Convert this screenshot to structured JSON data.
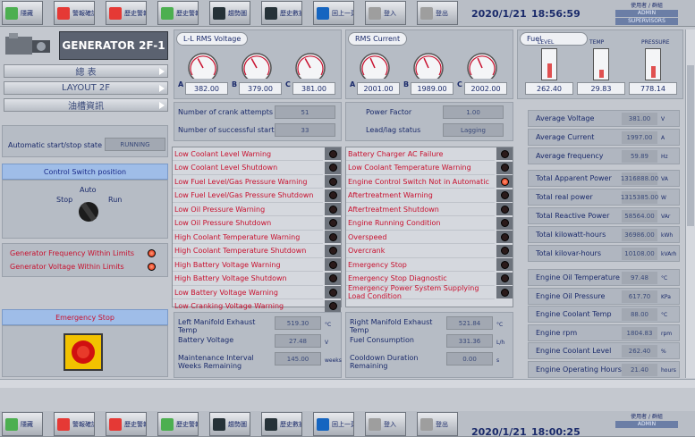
{
  "toolbar": {
    "buttons": [
      {
        "label": "隱藏",
        "color": "#4caf50"
      },
      {
        "label": "警報確認",
        "color": "#e53935"
      },
      {
        "label": "歷史警報",
        "color": "#e53935"
      },
      {
        "label": "歷史警報",
        "color": "#4caf50"
      },
      {
        "label": "趨勢圖",
        "color": "#263238"
      },
      {
        "label": "歷史數據",
        "color": "#263238"
      },
      {
        "label": "回上一頁",
        "color": "#1565c0"
      },
      {
        "label": "登入",
        "color": "#9e9e9e"
      },
      {
        "label": "登出",
        "color": "#9e9e9e"
      }
    ],
    "date": "2020/1/21",
    "time_top": "18:56:59",
    "time_bottom": "18:00:25",
    "user_label": "使用者 / 群組",
    "user": "ADMIN",
    "group": "SUPERVISORS"
  },
  "left": {
    "title": "GENERATOR 2F-1",
    "menu": [
      "總 表",
      "LAYOUT 2F",
      "油槽資訊"
    ],
    "auto_state_label": "Automatic start/stop state",
    "auto_state_value": "RUNNING",
    "control_switch_hdr": "Control Switch position",
    "switch_auto": "Auto",
    "switch_stop": "Stop",
    "switch_run": "Run",
    "freq_within": "Generator Frequency Within Limits",
    "volt_within": "Generator Voltage Within Limits",
    "estop_hdr": "Emergency Stop"
  },
  "voltage": {
    "tag": "L-L RMS Voltage",
    "phases": [
      {
        "p": "A",
        "v": "382.00",
        "level": 0.38
      },
      {
        "p": "B",
        "v": "379.00",
        "level": 0.38
      },
      {
        "p": "C",
        "v": "381.00",
        "level": 0.38
      }
    ]
  },
  "current": {
    "tag": "RMS Current",
    "phases": [
      {
        "p": "A",
        "v": "2001.00",
        "level": 0.4
      },
      {
        "p": "B",
        "v": "1989.00",
        "level": 0.4
      },
      {
        "p": "C",
        "v": "2002.00",
        "level": 0.4
      }
    ]
  },
  "fuel": {
    "tag": "Fuel",
    "gauges": [
      {
        "label": "LEVEL",
        "value": "262.40",
        "level": 0.55,
        "color": "#e05050"
      },
      {
        "label": "TEMP",
        "value": "29.83",
        "level": 0.3,
        "color": "#e05050"
      },
      {
        "label": "PRESSURE",
        "value": "778.14",
        "level": 0.45,
        "color": "#e05050"
      }
    ]
  },
  "counts": [
    {
      "label": "Number of crank attempts",
      "value": "51"
    },
    {
      "label": "Number of successful starts",
      "value": "33"
    }
  ],
  "pf": [
    {
      "label": "Power Factor",
      "value": "1.00"
    },
    {
      "label": "Lead/lag status",
      "value": "Lagging"
    }
  ],
  "alarms_left": [
    {
      "text": "Low Coolant Level Warning",
      "on": false
    },
    {
      "text": "Low Coolant Level Shutdown",
      "on": false
    },
    {
      "text": "Low Fuel Level/Gas Pressure Warning",
      "on": false
    },
    {
      "text": "Low Fuel Level/Gas Pressure Shutdown",
      "on": false
    },
    {
      "text": "Low Oil Pressure Warning",
      "on": false
    },
    {
      "text": "Low Oil Pressure Shutdown",
      "on": false
    },
    {
      "text": "High Coolant Temperature Warning",
      "on": false
    },
    {
      "text": "High Coolant Temperature Shutdown",
      "on": false
    },
    {
      "text": "High Battery Voltage Warning",
      "on": false
    },
    {
      "text": "High Battery Voltage Shutdown",
      "on": false
    },
    {
      "text": "Low Battery Voltage Warning",
      "on": false
    },
    {
      "text": "Low Cranking Voltage Warning",
      "on": false
    }
  ],
  "alarms_right": [
    {
      "text": "Battery Charger AC Failure",
      "on": false
    },
    {
      "text": "Low Coolant Temperature Warning",
      "on": false
    },
    {
      "text": "Engine Control Switch Not in Automatic",
      "on": true
    },
    {
      "text": "Aftertreatment Warning",
      "on": false
    },
    {
      "text": "Aftertreatment Shutdown",
      "on": false
    },
    {
      "text": "Engine Running Condition",
      "on": false
    },
    {
      "text": "Overspeed",
      "on": false
    },
    {
      "text": "Overcrank",
      "on": false
    },
    {
      "text": "Emergency Stop",
      "on": false
    },
    {
      "text": "Emergency Stop Diagnostic",
      "on": false
    },
    {
      "text": "Emergency Power System Supplying Load Condition",
      "on": false
    }
  ],
  "bottom_left": [
    {
      "label": "Left Manifold Exhaust Temp",
      "value": "519.30",
      "unit": "°C"
    },
    {
      "label": "Battery Voltage",
      "value": "27.48",
      "unit": "V"
    },
    {
      "label": "Maintenance Interval Weeks Remaining",
      "value": "145.00",
      "unit": "weeks"
    }
  ],
  "bottom_right": [
    {
      "label": "Right Manifold Exhaust Temp",
      "value": "521.84",
      "unit": "°C"
    },
    {
      "label": "Fuel Consumption",
      "value": "331.36",
      "unit": "L/h"
    },
    {
      "label": "Cooldown Duration Remaining",
      "value": "0.00",
      "unit": "s"
    }
  ],
  "summary_top": [
    {
      "label": "Average Voltage",
      "value": "381.00",
      "unit": "V"
    },
    {
      "label": "Average Current",
      "value": "1997.00",
      "unit": "A"
    },
    {
      "label": "Average frequency",
      "value": "59.89",
      "unit": "Hz"
    }
  ],
  "summary_power": [
    {
      "label": "Total Apparent Power",
      "value": "1316888.00",
      "unit": "VA"
    },
    {
      "label": "Total real power",
      "value": "1315385.00",
      "unit": "W"
    },
    {
      "label": "Total Reactive Power",
      "value": "58564.00",
      "unit": "VAr"
    },
    {
      "label": "Total kilowatt-hours",
      "value": "36986.00",
      "unit": "kWh"
    },
    {
      "label": "Total kilovar-hours",
      "value": "10108.00",
      "unit": "kVArh"
    }
  ],
  "summary_engine": [
    {
      "label": "Engine Oil Temperature",
      "value": "97.48",
      "unit": "°C"
    },
    {
      "label": "Engine Oil Pressure",
      "value": "617.70",
      "unit": "KPa"
    },
    {
      "label": "Engine Coolant Temp",
      "value": "88.00",
      "unit": "°C"
    },
    {
      "label": "Engine rpm",
      "value": "1804.83",
      "unit": "rpm"
    },
    {
      "label": "Engine Coolant Level",
      "value": "262.40",
      "unit": "%"
    },
    {
      "label": "Engine Operating Hours",
      "value": "21.40",
      "unit": "hours"
    }
  ]
}
